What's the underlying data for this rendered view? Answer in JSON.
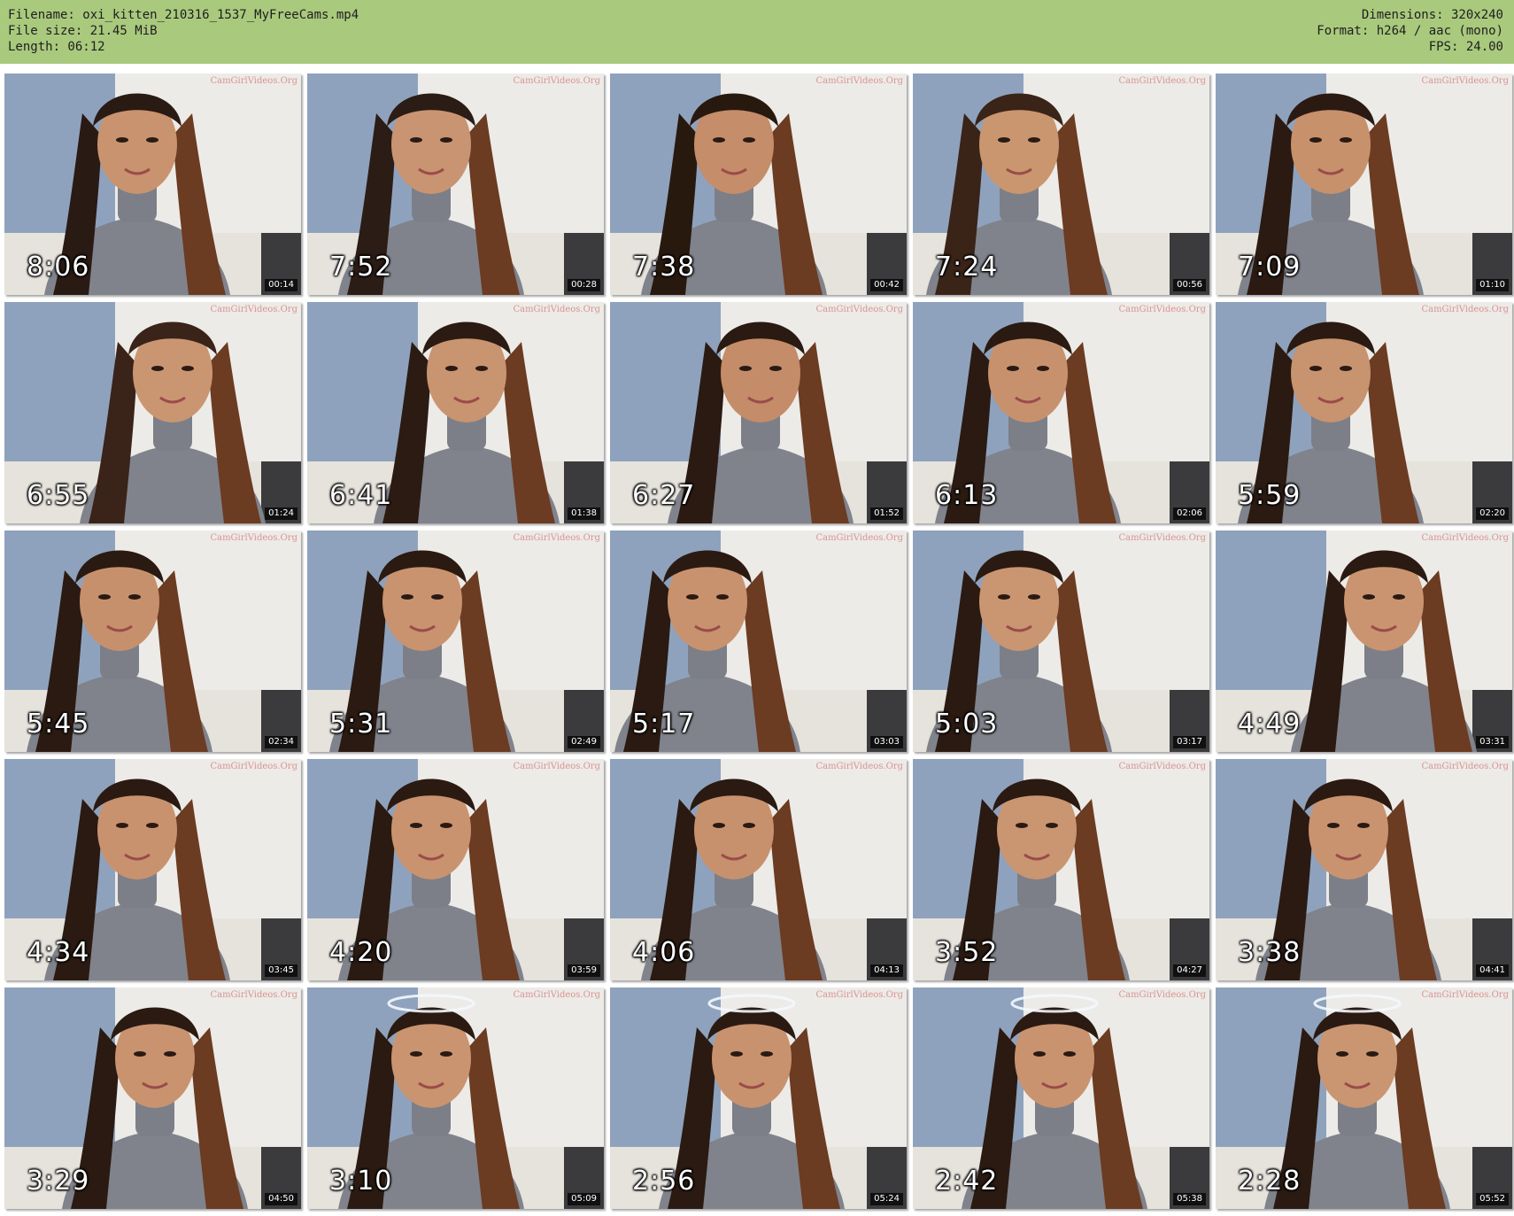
{
  "header": {
    "filename": "Filename: oxi_kitten_210316_1537_MyFreeCams.mp4",
    "file_size": "File size: 21.45 MiB",
    "length": "Length: 06:12",
    "dimensions": "Dimensions: 320x240",
    "format": "Format: h264 / aac (mono)",
    "fps": "FPS: 24.00",
    "background_color": "#a9c97d"
  },
  "watermark_text": "CamGirlVideos.Org",
  "thumbnails": [
    {
      "overlay": "8:06",
      "time": "00:14"
    },
    {
      "overlay": "7:52",
      "time": "00:28"
    },
    {
      "overlay": "7:38",
      "time": "00:42"
    },
    {
      "overlay": "7:24",
      "time": "00:56"
    },
    {
      "overlay": "7:09",
      "time": "01:10"
    },
    {
      "overlay": "6:55",
      "time": "01:24"
    },
    {
      "overlay": "6:41",
      "time": "01:38"
    },
    {
      "overlay": "6:27",
      "time": "01:52"
    },
    {
      "overlay": "6:13",
      "time": "02:06"
    },
    {
      "overlay": "5:59",
      "time": "02:20"
    },
    {
      "overlay": "5:45",
      "time": "02:34"
    },
    {
      "overlay": "5:31",
      "time": "02:49"
    },
    {
      "overlay": "5:17",
      "time": "03:03"
    },
    {
      "overlay": "5:03",
      "time": "03:17"
    },
    {
      "overlay": "4:49",
      "time": "03:31"
    },
    {
      "overlay": "4:34",
      "time": "03:45"
    },
    {
      "overlay": "4:20",
      "time": "03:59"
    },
    {
      "overlay": "4:06",
      "time": "04:13"
    },
    {
      "overlay": "3:52",
      "time": "04:27"
    },
    {
      "overlay": "3:38",
      "time": "04:41"
    },
    {
      "overlay": "3:29",
      "time": "04:50"
    },
    {
      "overlay": "3:10",
      "time": "05:09"
    },
    {
      "overlay": "2:56",
      "time": "05:24"
    },
    {
      "overlay": "2:42",
      "time": "05:38"
    },
    {
      "overlay": "2:28",
      "time": "05:52"
    }
  ]
}
